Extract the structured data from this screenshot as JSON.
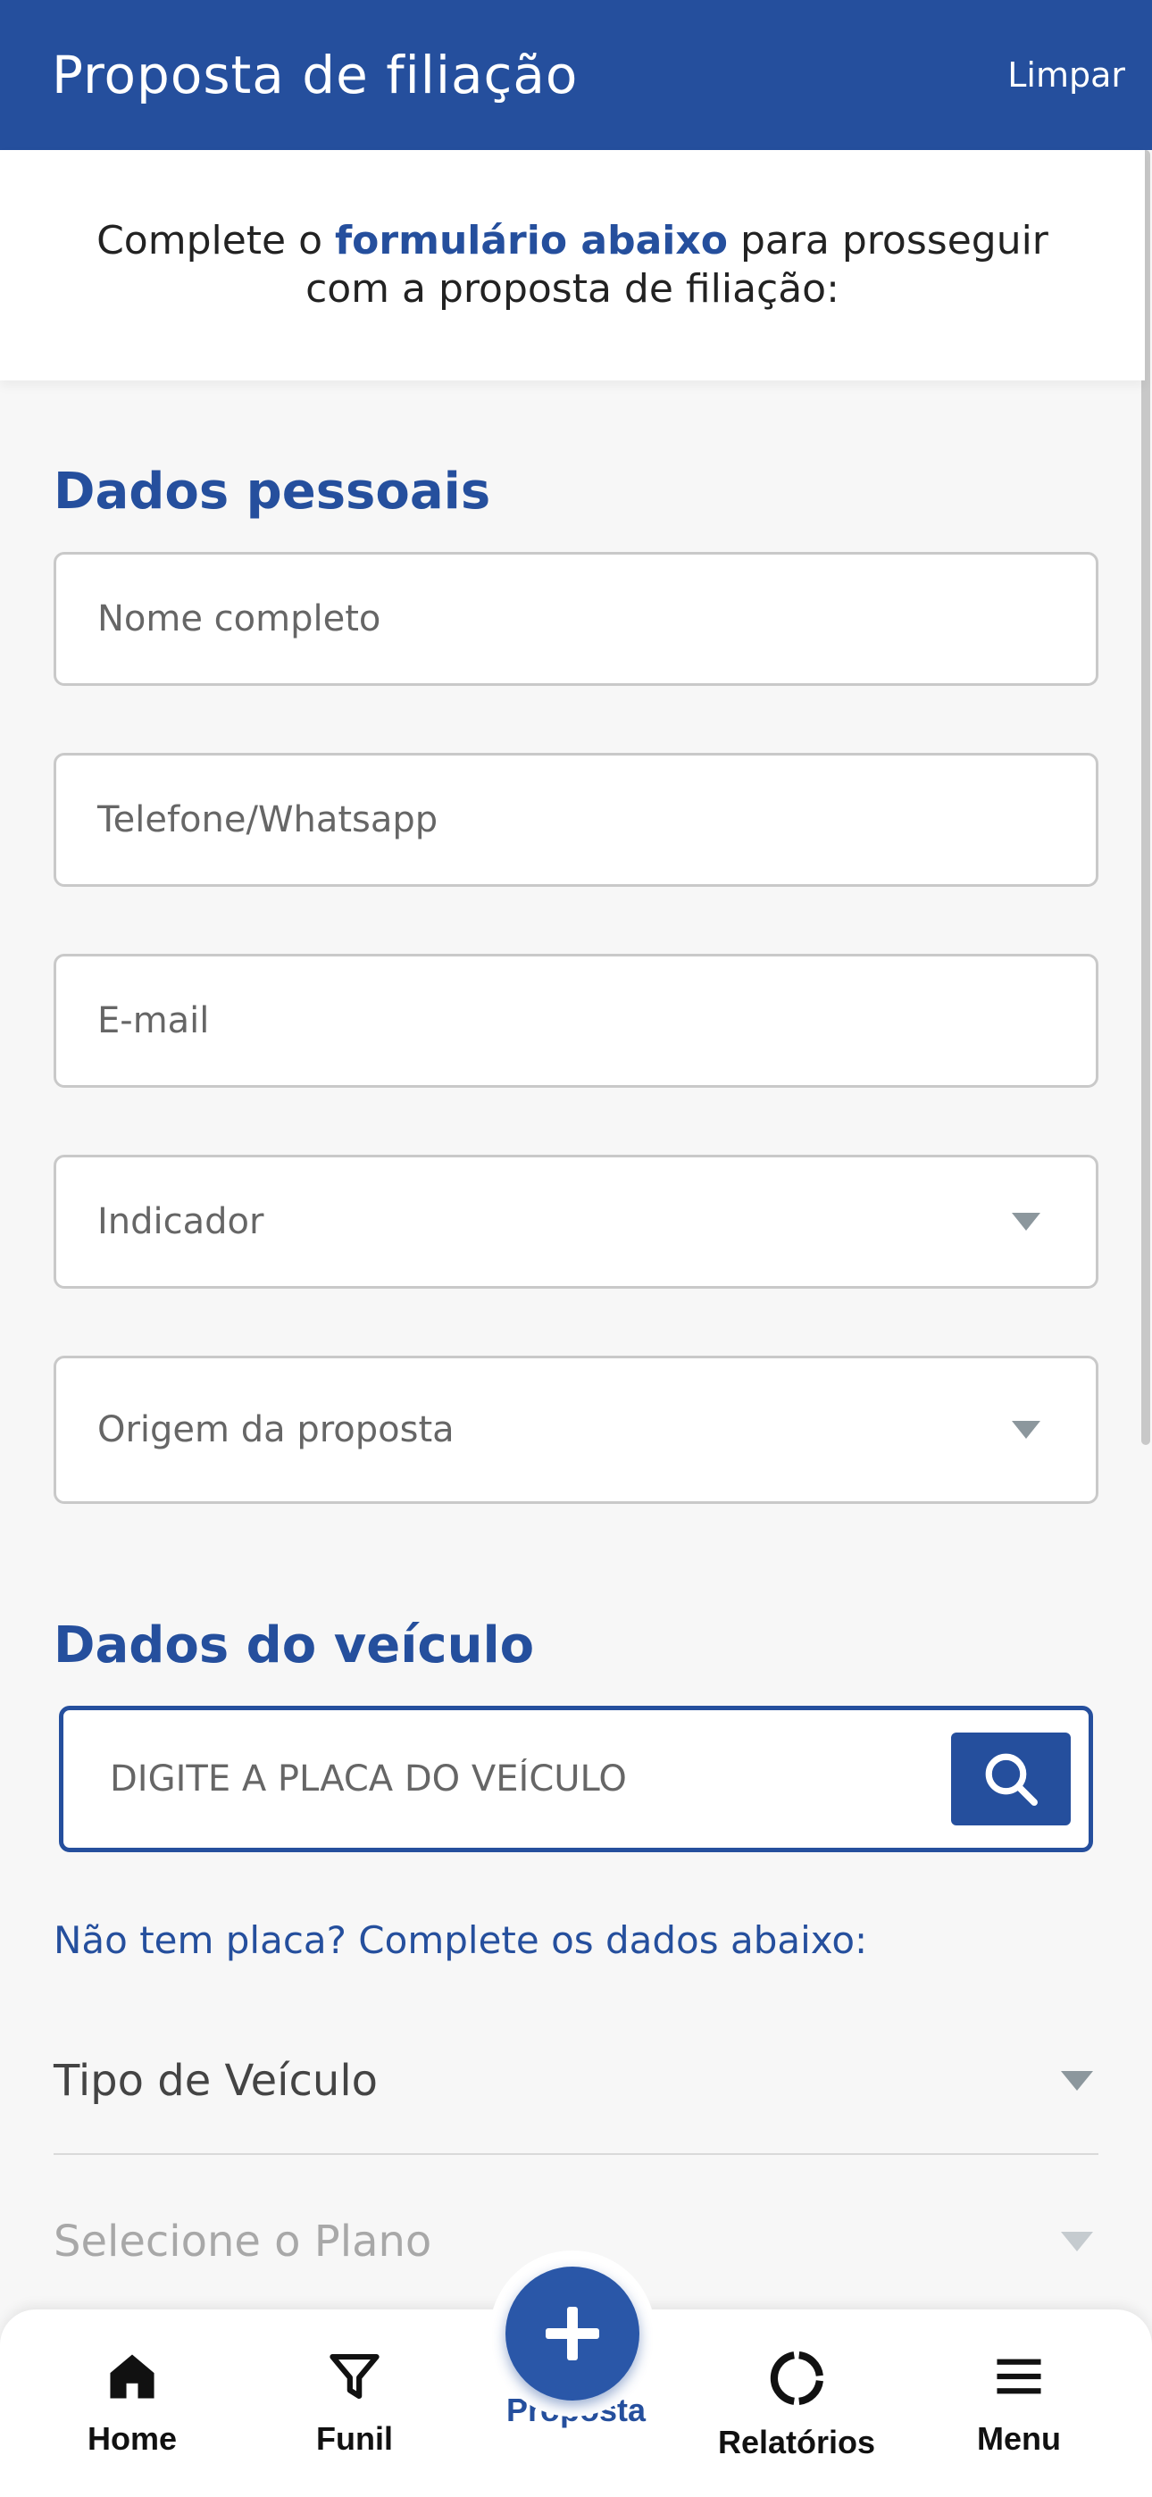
{
  "appbar": {
    "title": "Proposta de filiação",
    "action": "Limpar"
  },
  "intro": {
    "text_pre": "Complete o ",
    "text_bold": "formulário abaixo",
    "text_post": " para prosseguir com a proposta de filiação:"
  },
  "personal": {
    "title": "Dados pessoais",
    "name_placeholder": "Nome completo",
    "phone_placeholder": "Telefone/Whatsapp",
    "email_placeholder": "E-mail",
    "indicator_placeholder": "Indicador",
    "origin_placeholder": "Origem da proposta"
  },
  "vehicle": {
    "title": "Dados do veículo",
    "plate_placeholder": "DIGITE A PLACA DO VEÍCULO",
    "hint": "Não tem placa? Complete os dados abaixo:",
    "type_placeholder": "Tipo de Veículo",
    "plan_placeholder": "Selecione o Plano"
  },
  "nav": {
    "home": "Home",
    "funnel": "Funil",
    "proposal": "Proposta",
    "reports": "Relatórios",
    "menu": "Menu"
  },
  "colors": {
    "brand": "#254f9d",
    "muted": "#8c979d"
  }
}
